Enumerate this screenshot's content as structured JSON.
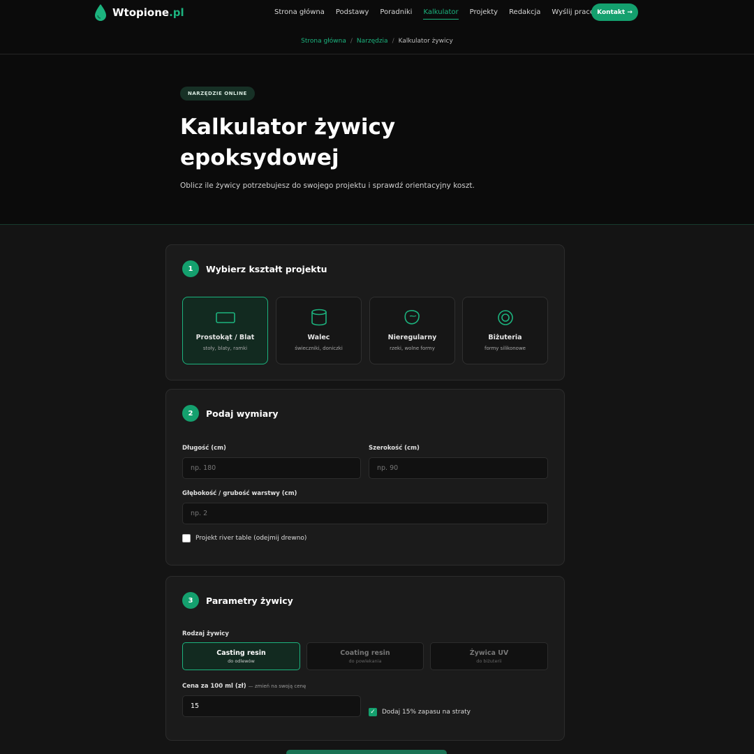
{
  "nav": {
    "logo_main": "Wtopione",
    "logo_tld": ".pl",
    "items": [
      {
        "label": "Strona główna"
      },
      {
        "label": "Podstawy"
      },
      {
        "label": "Poradniki"
      },
      {
        "label": "Kalkulator",
        "active": true
      },
      {
        "label": "Projekty"
      },
      {
        "label": "Redakcja"
      },
      {
        "label": "Wyślij pracę"
      }
    ],
    "cta": "Kontakt →"
  },
  "breadcrumb": {
    "items": [
      "Strona główna",
      "Narzędzia",
      "Kalkulator żywicy"
    ],
    "separator": "/"
  },
  "hero": {
    "badge": "NARZĘDZIE ONLINE",
    "title": "Kalkulator żywicy epoksydowej",
    "subtitle": "Oblicz ile żywicy potrzebujesz do swojego projektu i sprawdź orientacyjny koszt."
  },
  "step1": {
    "number": "1",
    "title": "Wybierz kształt projektu",
    "shapes": [
      {
        "name": "Prostokąt / Blat",
        "sub": "stoły, blaty, ramki",
        "icon": "rectangle-icon",
        "selected": true
      },
      {
        "name": "Walec",
        "sub": "świeczniki, doniczki",
        "icon": "cylinder-icon"
      },
      {
        "name": "Nieregularny",
        "sub": "rzeki, wolne formy",
        "icon": "blob-icon"
      },
      {
        "name": "Biżuteria",
        "sub": "formy silikonowe",
        "icon": "ring-icon"
      }
    ]
  },
  "step2": {
    "number": "2",
    "title": "Podaj wymiary",
    "length_label": "Długość (cm)",
    "length_placeholder": "np. 180",
    "width_label": "Szerokość (cm)",
    "width_placeholder": "np. 90",
    "depth_label": "Głębokość / grubość warstwy (cm)",
    "depth_placeholder": "np. 2",
    "river_label": "Projekt river table (odejmij drewno)",
    "river_checked": false
  },
  "step3": {
    "number": "3",
    "title": "Parametry żywicy",
    "type_label": "Rodzaj żywicy",
    "types": [
      {
        "name": "Casting resin",
        "sub": "do odlewów",
        "selected": true
      },
      {
        "name": "Coating resin",
        "sub": "do powlekania"
      },
      {
        "name": "Żywica UV",
        "sub": "do biżuterii"
      }
    ],
    "price_label": "Cena za 100 ml (zł)",
    "price_note": "— zmień na swoją cenę",
    "price_value": "15",
    "reserve_label": "Dodaj 15% zapasu na straty",
    "reserve_checked": true
  },
  "colors": {
    "accent": "#14a06e",
    "background": "#141414",
    "card": "#1b1b1b"
  }
}
